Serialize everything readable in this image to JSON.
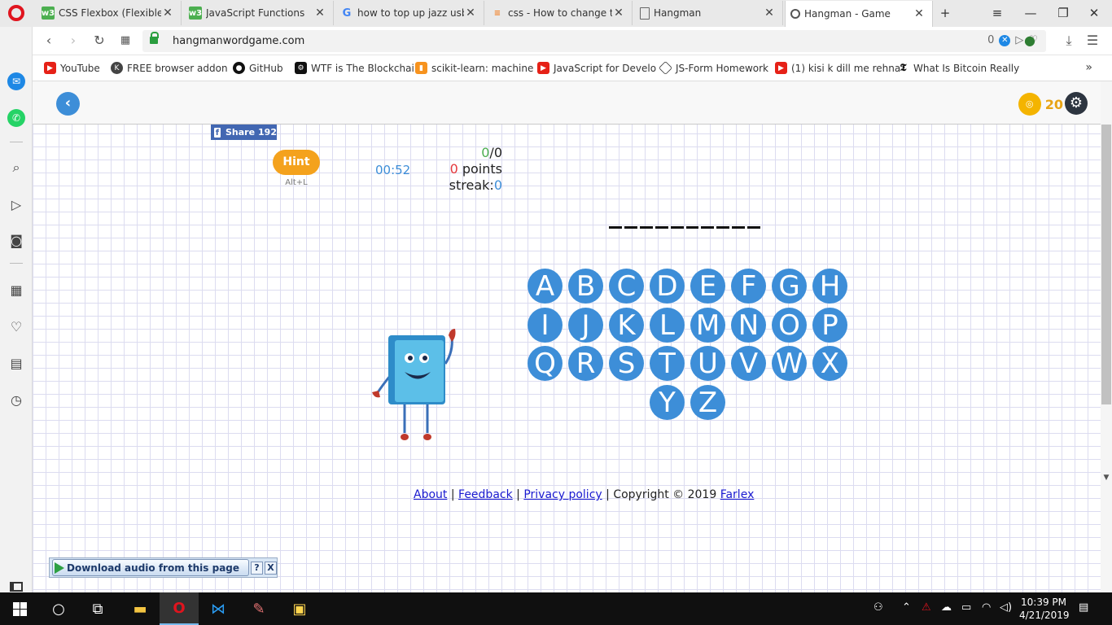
{
  "browser": {
    "tabs": [
      {
        "title": "CSS Flexbox (Flexible Bo",
        "icon": "w3schools-icon"
      },
      {
        "title": "JavaScript Functions",
        "icon": "w3schools-icon"
      },
      {
        "title": "how to top up jazz usb -",
        "icon": "google-icon"
      },
      {
        "title": "css - How to change the",
        "icon": "stackoverflow-icon"
      },
      {
        "title": "Hangman",
        "icon": "page-icon"
      },
      {
        "title": "Hangman - Game",
        "icon": "loading-icon",
        "active": true
      }
    ],
    "url": "hangmanwordgame.com",
    "tracker_count": "0",
    "bookmarks": [
      {
        "label": "YouTube"
      },
      {
        "label": "FREE browser addon"
      },
      {
        "label": "GitHub"
      },
      {
        "label": "WTF is The Blockchai"
      },
      {
        "label": "scikit-learn: machine"
      },
      {
        "label": "JavaScript for Develo"
      },
      {
        "label": "JS-Form Homework"
      },
      {
        "label": "(1) kisi k dill me rehna"
      },
      {
        "label": "What Is Bitcoin Really"
      }
    ]
  },
  "game": {
    "coins": "20",
    "share_label": "Share",
    "share_count": "192",
    "hint_label": "Hint",
    "hint_shortcut": "Alt+L",
    "timer": "00:52",
    "score_correct": "0",
    "score_total": "/0",
    "points_value": "0",
    "points_label": "points",
    "streak_label": "streak:",
    "streak_value": "0",
    "word_length": 10,
    "letters": [
      "A",
      "B",
      "C",
      "D",
      "E",
      "F",
      "G",
      "H",
      "I",
      "J",
      "K",
      "L",
      "M",
      "N",
      "O",
      "P",
      "Q",
      "R",
      "S",
      "T",
      "U",
      "V",
      "W",
      "X",
      "Y",
      "Z"
    ]
  },
  "footer": {
    "about": "About",
    "feedback": "Feedback",
    "privacy": "Privacy policy",
    "copyright": "Copyright © 2019",
    "farlex": "Farlex"
  },
  "audio_bar": {
    "label": "Download audio from this page",
    "help": "?",
    "close": "X"
  },
  "taskbar": {
    "time": "10:39 PM",
    "date": "4/21/2019"
  },
  "colors": {
    "accent_blue": "#3d8ed8",
    "hint_orange": "#f4a21d",
    "coin_gold": "#f4b400"
  }
}
